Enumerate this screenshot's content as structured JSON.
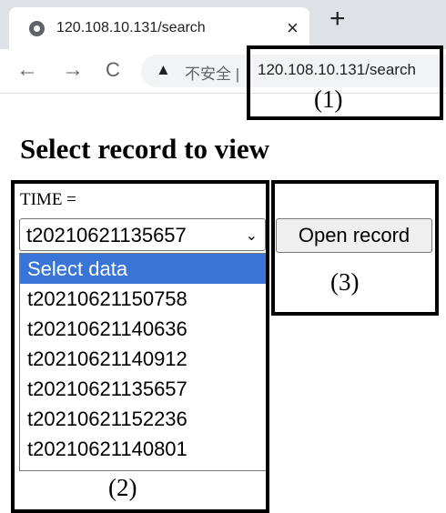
{
  "browser": {
    "tab_title": "120.108.10.131/search",
    "tab_close": "×",
    "new_tab": "+",
    "nav": {
      "back": "←",
      "forward": "→",
      "reload": "C"
    },
    "security_icon": "▲",
    "security_text": "不安全 |",
    "url": "120.108.10.131/search"
  },
  "annotations": {
    "one": "(1)",
    "two": "(2)",
    "three": "(3)"
  },
  "page": {
    "heading": "Select record to view",
    "time_label": "TIME =",
    "select": {
      "value": "t20210621135657",
      "caret": "⌄",
      "options": [
        "Select data",
        "t20210621150758",
        "t20210621140636",
        "t20210621140912",
        "t20210621135657",
        "t20210621152236",
        "t20210621140801"
      ]
    },
    "open_button": "Open record"
  }
}
